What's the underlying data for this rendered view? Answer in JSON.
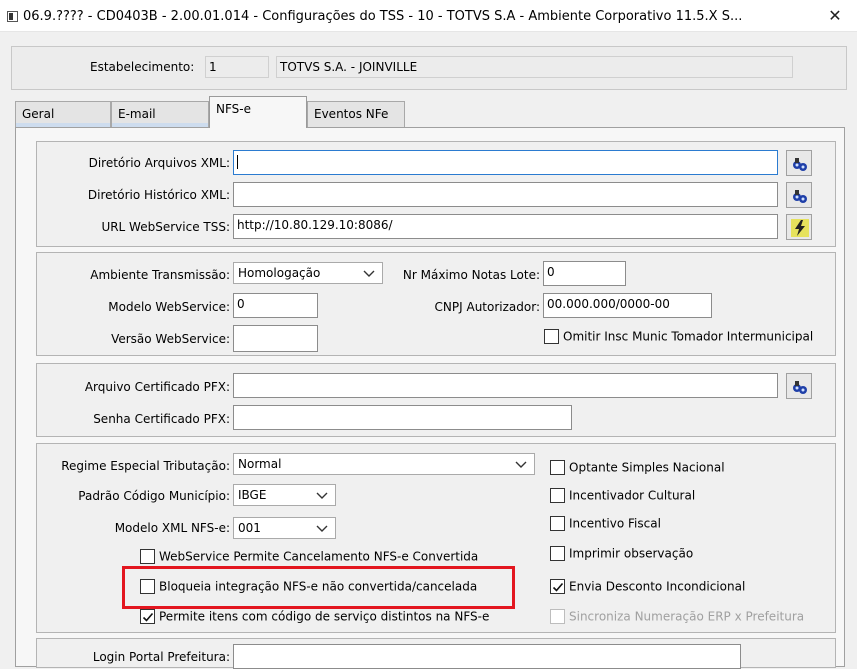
{
  "window": {
    "title": "06.9.???? - CD0403B - 2.00.01.014 - Configurações do TSS - 10 - TOTVS S.A - Ambiente Corporativo 11.5.X S...",
    "close_glyph": "✕"
  },
  "estabelecimento": {
    "label": "Estabelecimento:",
    "code": "1",
    "name": "TOTVS S.A. - JOINVILLE"
  },
  "tabs": [
    {
      "label": "Geral"
    },
    {
      "label": "E-mail"
    },
    {
      "label": "NFS-e"
    },
    {
      "label": "Eventos NFe"
    }
  ],
  "xml_group": {
    "dir_xml_label": "Diretório Arquivos XML:",
    "dir_xml_value": "",
    "dir_hist_label": "Diretório Histórico XML:",
    "dir_hist_value": "",
    "url_label": "URL WebService TSS:",
    "url_value": "http://10.80.129.10:8086/"
  },
  "env_group": {
    "ambiente_label": "Ambiente Transmissão:",
    "ambiente_value": "Homologação",
    "nr_max_label": "Nr Máximo Notas Lote:",
    "nr_max_value": "0",
    "modelo_ws_label": "Modelo WebService:",
    "modelo_ws_value": "0",
    "cnpj_label": "CNPJ Autorizador:",
    "cnpj_value": "00.000.000/0000-00",
    "versao_ws_label": "Versão WebService:",
    "versao_ws_value": "",
    "omitir_label": "Omitir Insc Munic Tomador Intermunicipal",
    "omitir_checked": false
  },
  "cert_group": {
    "arquivo_label": "Arquivo Certificado PFX:",
    "arquivo_value": "",
    "senha_label": "Senha Certificado PFX:",
    "senha_value": ""
  },
  "regime_group": {
    "regime_label": "Regime Especial Tributação:",
    "regime_value": "Normal",
    "padrao_label": "Padrão Código Município:",
    "padrao_value": "IBGE",
    "modelo_xml_label": "Modelo XML NFS-e:",
    "modelo_xml_value": "001",
    "ws_cancel_label": "WebService Permite Cancelamento NFS-e Convertida",
    "bloqueia_label": "Bloqueia integração NFS-e não convertida/cancelada",
    "permite_label": "Permite itens com código de serviço distintos na NFS-e",
    "optante_label": "Optante Simples Nacional",
    "incentivador_label": "Incentivador Cultural",
    "incentivo_label": "Incentivo Fiscal",
    "imprimir_label": "Imprimir observação",
    "envia_label": "Envia Desconto Incondicional",
    "sincroniza_label": "Sincroniza Numeração ERP x Prefeitura"
  },
  "login_group": {
    "login_label": "Login Portal Prefeitura:"
  },
  "colors": {
    "highlight": "#e3161f",
    "tab_hint": "#cddcee",
    "focus": "#2b7bd0"
  }
}
